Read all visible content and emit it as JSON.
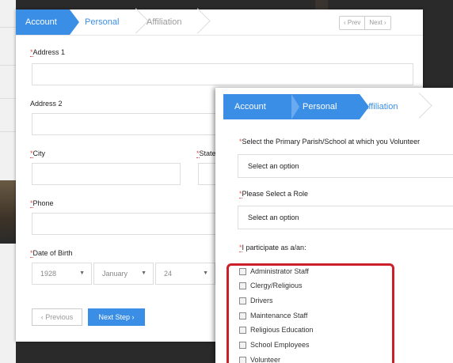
{
  "panel_back": {
    "wizard": {
      "step1": "Account",
      "step2": "Personal",
      "step3": "Affiliation"
    },
    "pager": {
      "prev": "‹  Prev",
      "next": "Next  ›"
    },
    "fields": {
      "address1_label": "Address 1",
      "address2_label": "Address 2",
      "city_label": "City",
      "state_label": "State",
      "phone_label": "Phone",
      "dob_label": "Date of Birth",
      "req_marker": "*"
    },
    "dob": {
      "year": "1928",
      "month": "January",
      "day": "24"
    },
    "buttons": {
      "previous": "‹  Previous",
      "next_step": "Next Step  ›"
    }
  },
  "panel_front": {
    "wizard": {
      "step1": "Account",
      "step2": "Personal",
      "step3": "Affiliation"
    },
    "parish_label": "Select the Primary Parish/School at which you Volunteer",
    "parish_value": "Select an option",
    "role_label": "Please Select a Role",
    "role_value": "Select an option",
    "participate_label": "I participate as a/an:",
    "req_marker": "*",
    "options": [
      "Administrator Staff",
      "Clergy/Religious",
      "Drivers",
      "Maintenance Staff",
      "Religious Education",
      "School Employees",
      "Volunteer"
    ]
  },
  "colors": {
    "accent": "#3b8ee6",
    "required": "#d9534f",
    "highlight": "#cc1f2a"
  }
}
